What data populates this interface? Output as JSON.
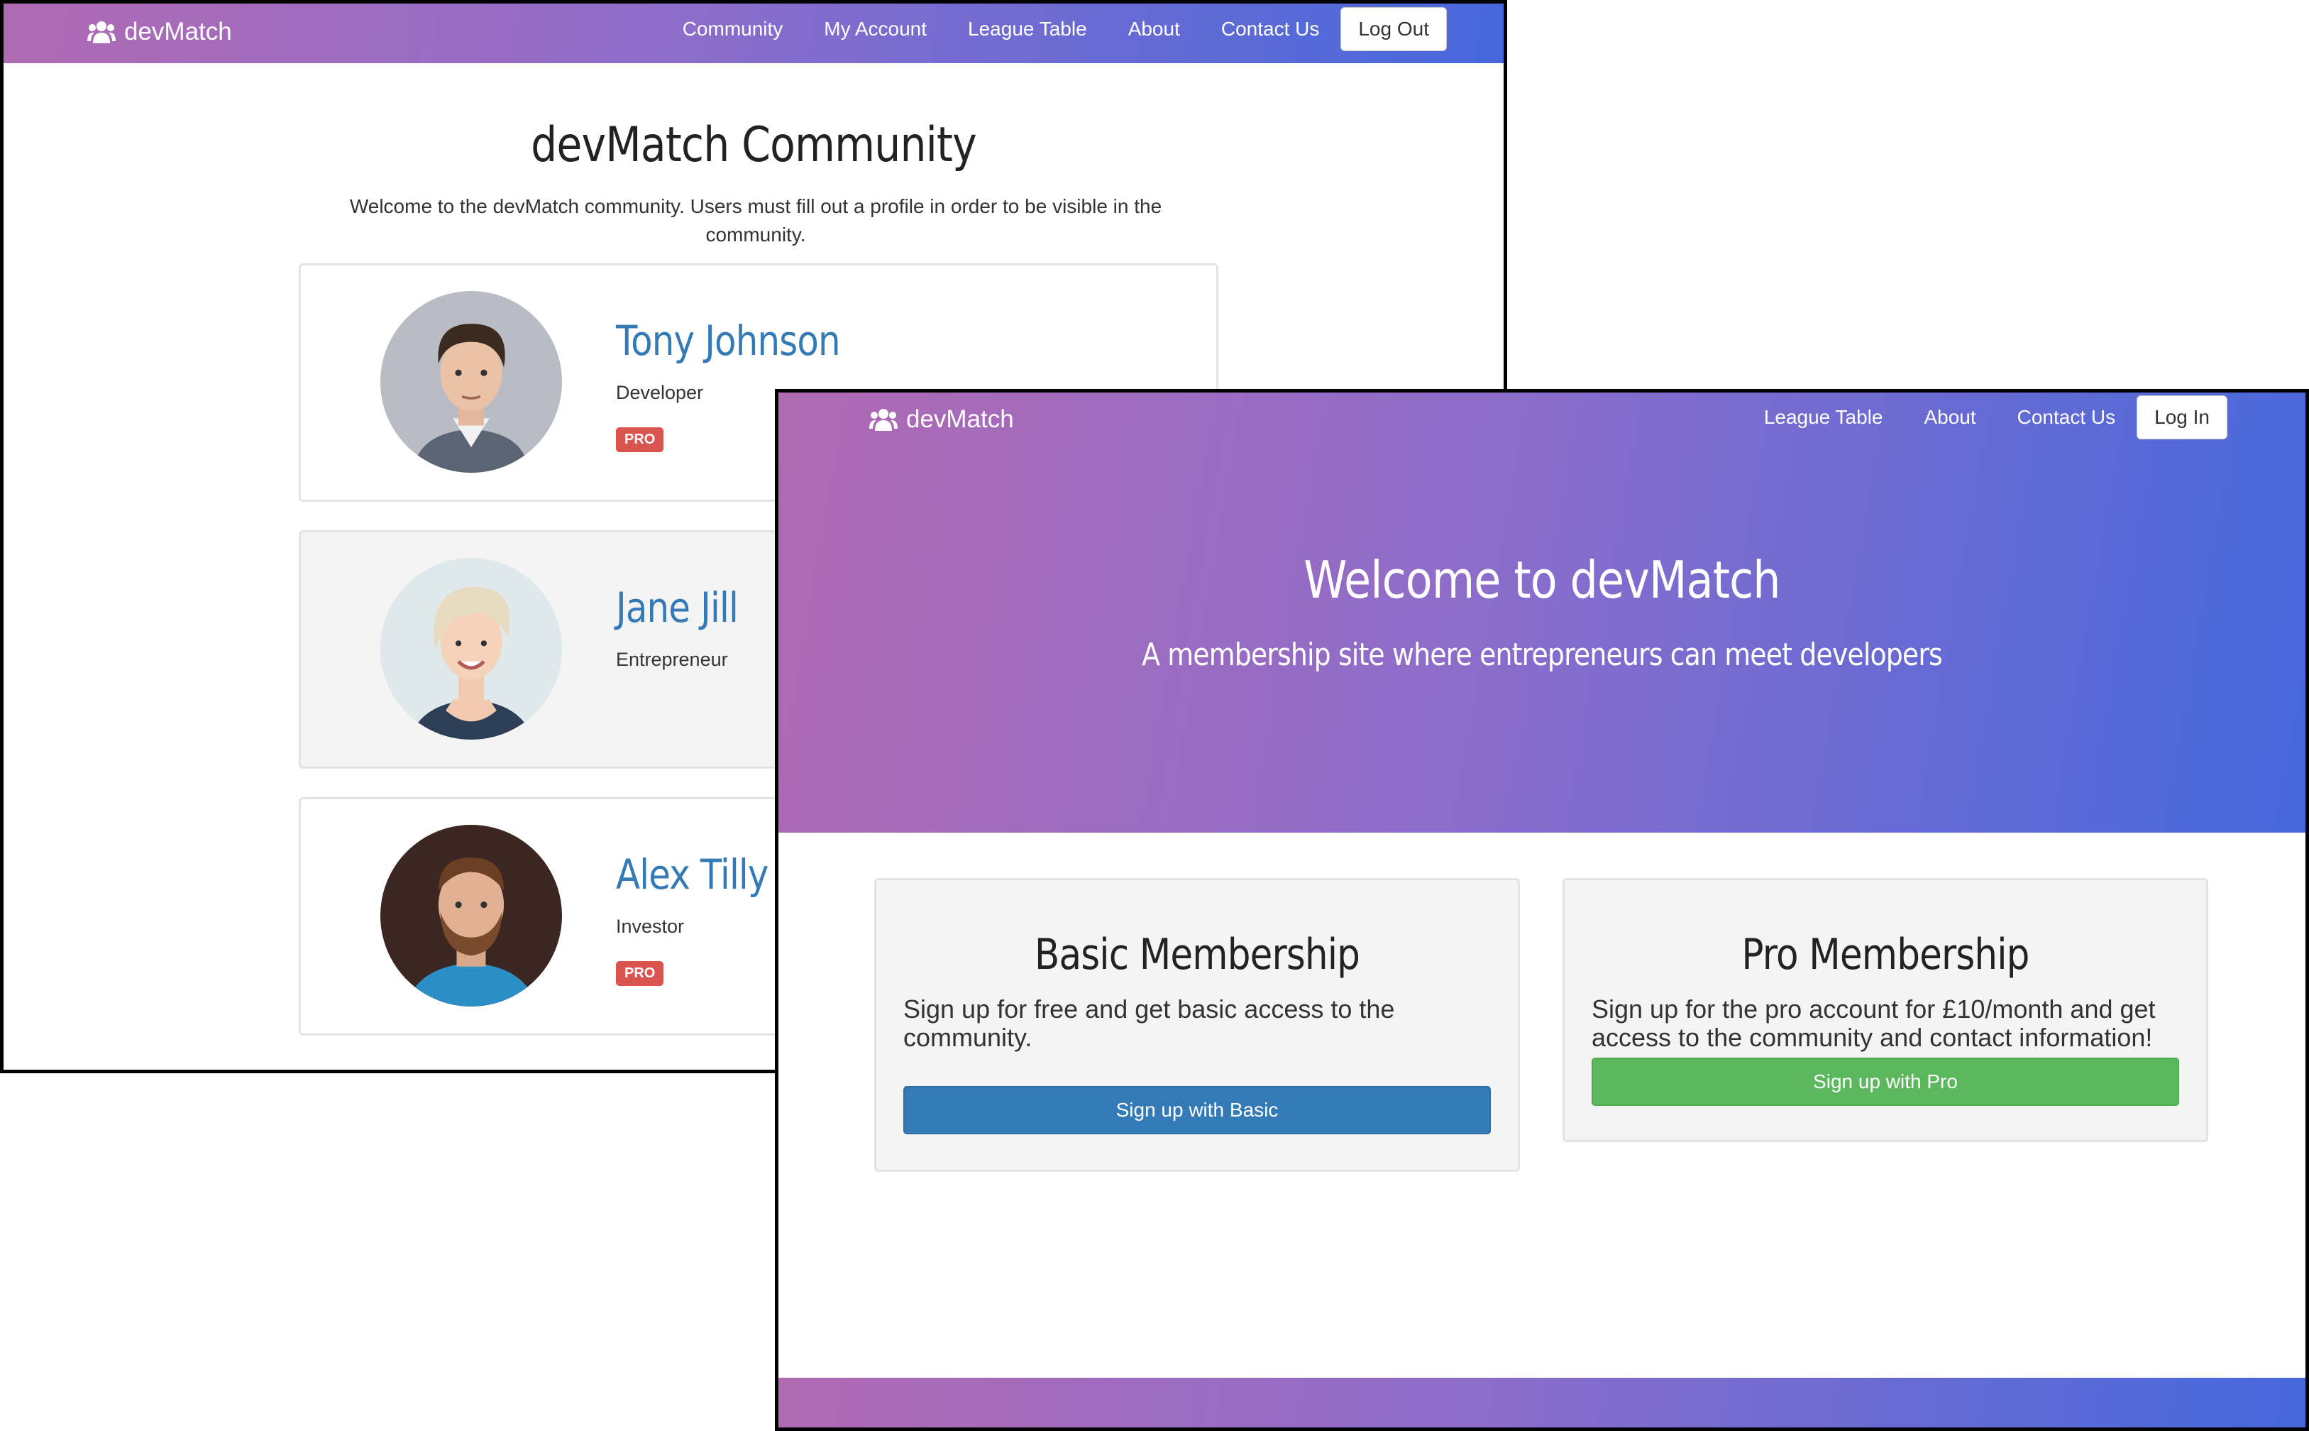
{
  "community_page": {
    "brand": "devMatch",
    "nav": {
      "links": [
        "Community",
        "My Account",
        "League Table",
        "About",
        "Contact Us"
      ],
      "button": "Log Out"
    },
    "title": "devMatch Community",
    "intro": "Welcome to the devMatch community. Users must fill out a profile in order to be visible in the community.",
    "members": [
      {
        "name": "Tony Johnson",
        "role": "Developer",
        "badge": "PRO"
      },
      {
        "name": "Jane Jill",
        "role": "Entrepreneur",
        "badge": ""
      },
      {
        "name": "Alex Tilly",
        "role": "Investor",
        "badge": "PRO"
      }
    ]
  },
  "landing_page": {
    "brand": "devMatch",
    "nav": {
      "links": [
        "League Table",
        "About",
        "Contact Us"
      ],
      "button": "Log In"
    },
    "hero": {
      "title": "Welcome to devMatch",
      "subtitle": "A membership site where entrepreneurs can meet developers"
    },
    "plans": [
      {
        "title": "Basic Membership",
        "description": "Sign up for free and get basic access to the community.",
        "button": "Sign up with Basic"
      },
      {
        "title": "Pro Membership",
        "description": "Sign up for the pro account for £10/month and get access to the community and contact information!",
        "button": "Sign up with Pro"
      }
    ]
  },
  "colors": {
    "gradient_start": "#b06ab3",
    "gradient_end": "#4568dc",
    "link_blue": "#337ab7",
    "pro_badge": "#d9534f",
    "basic_button": "#337ab7",
    "pro_button": "#5cb85c"
  },
  "icons": {
    "brand": "users-icon"
  }
}
